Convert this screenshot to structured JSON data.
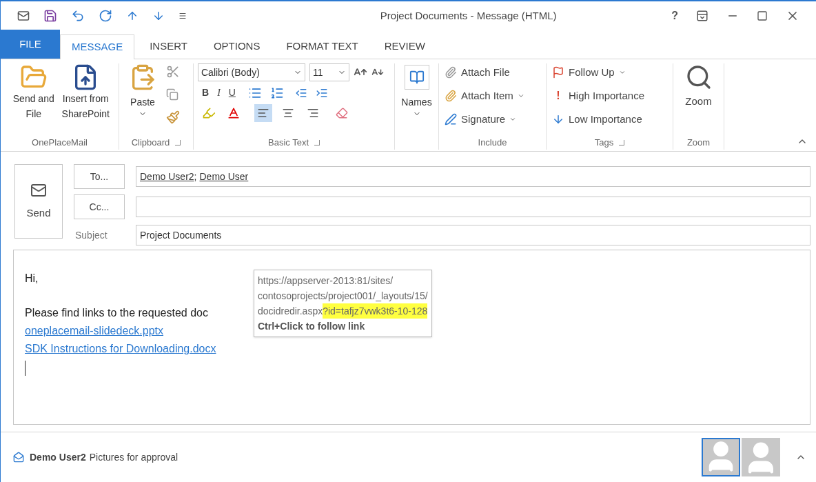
{
  "window": {
    "title": "Project Documents - Message (HTML)",
    "help": "?"
  },
  "tabs": [
    {
      "label": "FILE",
      "kind": "file",
      "selected": false
    },
    {
      "label": "MESSAGE",
      "kind": "tab",
      "selected": true
    },
    {
      "label": "INSERT",
      "kind": "tab",
      "selected": false
    },
    {
      "label": "OPTIONS",
      "kind": "tab",
      "selected": false
    },
    {
      "label": "FORMAT TEXT",
      "kind": "tab",
      "selected": false
    },
    {
      "label": "REVIEW",
      "kind": "tab",
      "selected": false
    }
  ],
  "ribbon": {
    "oneplacemail": {
      "label": "OnePlaceMail",
      "buttons": [
        "Send and File",
        "Insert from SharePoint"
      ]
    },
    "clipboard": {
      "label": "Clipboard",
      "paste": "Paste"
    },
    "basic_text": {
      "label": "Basic Text",
      "font": "Calibri (Body)",
      "size": "11",
      "styles": [
        "B",
        "I",
        "U"
      ],
      "align": [
        {
          "selected": true
        },
        {
          "selected": false
        },
        {
          "selected": false
        }
      ]
    },
    "names": {
      "label": "Names"
    },
    "include": {
      "label": "Include",
      "items": [
        {
          "label": "Attach File",
          "dropdown": false
        },
        {
          "label": "Attach Item",
          "dropdown": true
        },
        {
          "label": "Signature",
          "dropdown": true
        }
      ]
    },
    "tags": {
      "label": "Tags",
      "items": [
        {
          "label": "Follow Up",
          "dropdown": true
        },
        {
          "label": "High Importance",
          "dropdown": false,
          "icon": "!"
        },
        {
          "label": "Low Importance",
          "dropdown": false
        }
      ]
    },
    "zoom": {
      "button": "Zoom",
      "label": "Zoom"
    }
  },
  "compose": {
    "send": "Send",
    "to_button": "To...",
    "recipients": [
      "Demo User2",
      "Demo User"
    ],
    "recipient_separator": ";",
    "cc_button": "Cc...",
    "subject_label": "Subject",
    "subject": "Project Documents"
  },
  "body": {
    "greeting": "Hi,",
    "sentence": "Please find links to the requested doc",
    "links": [
      "oneplacemail-slidedeck.pptx",
      "SDK Instructions for Downloading.docx"
    ]
  },
  "tooltip": {
    "lines": [
      "https://appserver-2013:81/sites/",
      "contosoprojects/project001/_layouts/15/"
    ],
    "url_end": "docidredir.aspx",
    "highlight": "?id=tafjz7vwk3t6-10-128",
    "hint": "Ctrl+Click to follow link"
  },
  "people_pane": {
    "sender": "Demo User2",
    "subject": "Pictures for approval",
    "avatars": [
      {
        "selected": true
      },
      {
        "selected": false
      }
    ]
  }
}
